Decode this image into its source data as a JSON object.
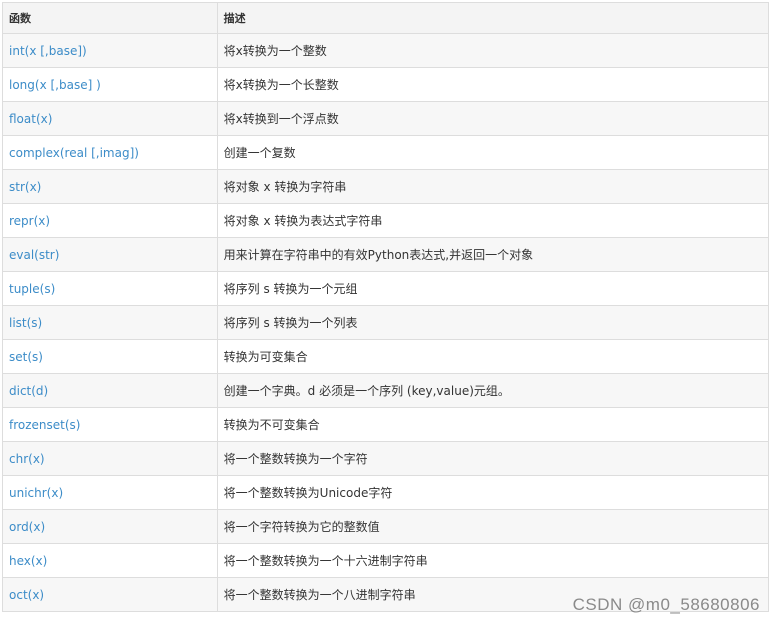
{
  "table": {
    "headers": {
      "function": "函数",
      "description": "描述"
    },
    "rows": [
      {
        "function": "int(x [,base])",
        "description": "将x转换为一个整数"
      },
      {
        "function": "long(x [,base] )",
        "description": "将x转换为一个长整数"
      },
      {
        "function": "float(x)",
        "description": "将x转换到一个浮点数"
      },
      {
        "function": "complex(real [,imag])",
        "description": "创建一个复数"
      },
      {
        "function": "str(x)",
        "description": "将对象 x 转换为字符串"
      },
      {
        "function": "repr(x)",
        "description": "将对象 x 转换为表达式字符串"
      },
      {
        "function": "eval(str)",
        "description": "用来计算在字符串中的有效Python表达式,并返回一个对象"
      },
      {
        "function": "tuple(s)",
        "description": "将序列 s 转换为一个元组"
      },
      {
        "function": "list(s)",
        "description": "将序列 s 转换为一个列表"
      },
      {
        "function": "set(s)",
        "description": "转换为可变集合"
      },
      {
        "function": "dict(d)",
        "description": "创建一个字典。d 必须是一个序列 (key,value)元组。"
      },
      {
        "function": "frozenset(s)",
        "description": "转换为不可变集合"
      },
      {
        "function": "chr(x)",
        "description": "将一个整数转换为一个字符"
      },
      {
        "function": "unichr(x)",
        "description": "将一个整数转换为Unicode字符"
      },
      {
        "function": "ord(x)",
        "description": "将一个字符转换为它的整数值"
      },
      {
        "function": "hex(x)",
        "description": "将一个整数转换为一个十六进制字符串"
      },
      {
        "function": "oct(x)",
        "description": "将一个整数转换为一个八进制字符串"
      }
    ]
  },
  "watermark": "CSDN @m0_58680806",
  "colors": {
    "function_text": "#3c8cc8",
    "description_text": "#333333",
    "border": "#dddddd",
    "header_bg": "#f4f4f4",
    "odd_row_bg": "#f7f7f7"
  }
}
